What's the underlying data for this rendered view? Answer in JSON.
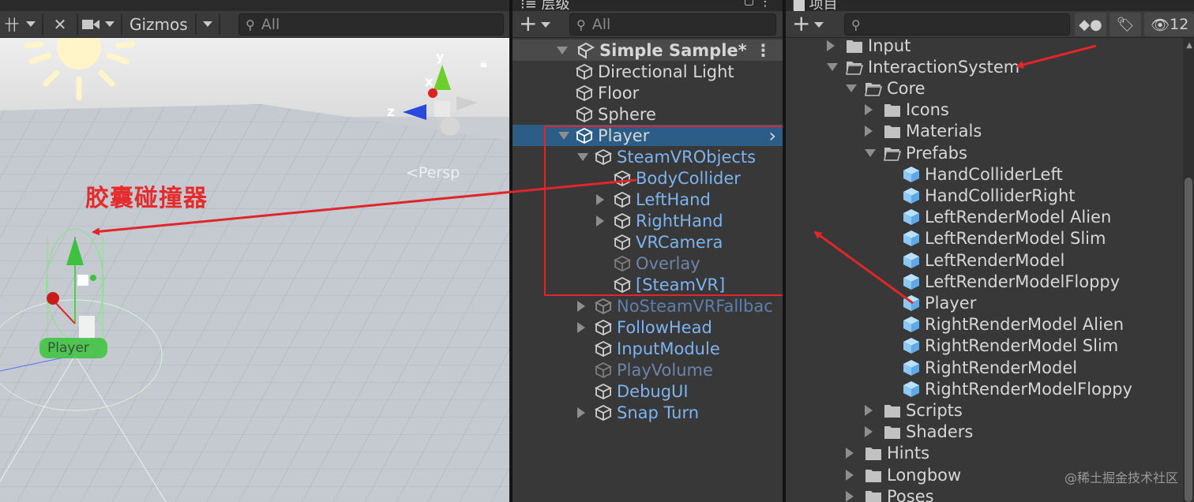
{
  "scene": {
    "toolbar": {
      "tool_icon": "move-tool-icon",
      "gizmos_label": "Gizmos",
      "search_placeholder": "All"
    },
    "persp_label": "<Persp",
    "axis_labels": {
      "y": "y",
      "x": "x",
      "z": "z"
    },
    "annotation": "胶囊碰撞器",
    "player_label": "Player"
  },
  "hierarchy": {
    "tab_label": "层级",
    "search_placeholder": "All",
    "scene_name": "Simple Sample*",
    "items": [
      {
        "label": "Directional Light",
        "indent": 0,
        "fold": "none",
        "style": "white"
      },
      {
        "label": "Floor",
        "indent": 0,
        "fold": "none",
        "style": "white"
      },
      {
        "label": "Sphere",
        "indent": 0,
        "fold": "none",
        "style": "white"
      },
      {
        "label": "Player",
        "indent": 0,
        "fold": "open",
        "style": "white",
        "selected": true
      },
      {
        "label": "SteamVRObjects",
        "indent": 1,
        "fold": "open",
        "style": "blue"
      },
      {
        "label": "BodyCollider",
        "indent": 2,
        "fold": "none",
        "style": "blue"
      },
      {
        "label": "LeftHand",
        "indent": 2,
        "fold": "closed",
        "style": "blue"
      },
      {
        "label": "RightHand",
        "indent": 2,
        "fold": "closed",
        "style": "blue"
      },
      {
        "label": "VRCamera",
        "indent": 2,
        "fold": "none",
        "style": "blue"
      },
      {
        "label": "Overlay",
        "indent": 2,
        "fold": "none",
        "style": "dim"
      },
      {
        "label": "[SteamVR]",
        "indent": 2,
        "fold": "none",
        "style": "blue"
      },
      {
        "label": "NoSteamVRFallbac",
        "indent": 1,
        "fold": "closed",
        "style": "dimblue"
      },
      {
        "label": "FollowHead",
        "indent": 1,
        "fold": "closed",
        "style": "blue"
      },
      {
        "label": "InputModule",
        "indent": 1,
        "fold": "none",
        "style": "blue"
      },
      {
        "label": "PlayVolume",
        "indent": 1,
        "fold": "none",
        "style": "dim"
      },
      {
        "label": "DebugUI",
        "indent": 1,
        "fold": "none",
        "style": "blue"
      },
      {
        "label": "Snap Turn",
        "indent": 1,
        "fold": "closed",
        "style": "blue"
      }
    ]
  },
  "project": {
    "tab_label": "项目",
    "hidden_count": "12",
    "items": [
      {
        "label": "Input",
        "indent": 0,
        "fold": "closed",
        "type": "folder"
      },
      {
        "label": "InteractionSystem",
        "indent": 0,
        "fold": "open",
        "type": "folder-open"
      },
      {
        "label": "Core",
        "indent": 1,
        "fold": "open",
        "type": "folder-open"
      },
      {
        "label": "Icons",
        "indent": 2,
        "fold": "closed",
        "type": "folder"
      },
      {
        "label": "Materials",
        "indent": 2,
        "fold": "closed",
        "type": "folder"
      },
      {
        "label": "Prefabs",
        "indent": 2,
        "fold": "open",
        "type": "folder-open"
      },
      {
        "label": "HandColliderLeft",
        "indent": 3,
        "fold": "none",
        "type": "prefab"
      },
      {
        "label": "HandColliderRight",
        "indent": 3,
        "fold": "none",
        "type": "prefab"
      },
      {
        "label": "LeftRenderModel Alien",
        "indent": 3,
        "fold": "none",
        "type": "prefab"
      },
      {
        "label": "LeftRenderModel Slim",
        "indent": 3,
        "fold": "none",
        "type": "prefab"
      },
      {
        "label": "LeftRenderModel",
        "indent": 3,
        "fold": "none",
        "type": "prefab"
      },
      {
        "label": "LeftRenderModelFloppy",
        "indent": 3,
        "fold": "none",
        "type": "prefab"
      },
      {
        "label": "Player",
        "indent": 3,
        "fold": "none",
        "type": "prefab"
      },
      {
        "label": "RightRenderModel Alien",
        "indent": 3,
        "fold": "none",
        "type": "prefab"
      },
      {
        "label": "RightRenderModel Slim",
        "indent": 3,
        "fold": "none",
        "type": "prefab"
      },
      {
        "label": "RightRenderModel",
        "indent": 3,
        "fold": "none",
        "type": "prefab"
      },
      {
        "label": "RightRenderModelFloppy",
        "indent": 3,
        "fold": "none",
        "type": "prefab"
      },
      {
        "label": "Scripts",
        "indent": 2,
        "fold": "closed",
        "type": "folder"
      },
      {
        "label": "Shaders",
        "indent": 2,
        "fold": "closed",
        "type": "folder"
      },
      {
        "label": "Hints",
        "indent": 1,
        "fold": "closed",
        "type": "folder"
      },
      {
        "label": "Longbow",
        "indent": 1,
        "fold": "closed",
        "type": "folder"
      },
      {
        "label": "Poses",
        "indent": 1,
        "fold": "closed",
        "type": "folder"
      }
    ]
  },
  "watermark": "@稀土掘金技术社区",
  "colors": {
    "annotation_red": "#e0262a",
    "selection_blue": "#2c5d87",
    "prefab_blue": "#7cb3f0",
    "prefab_icon": "#8cc8f2"
  }
}
